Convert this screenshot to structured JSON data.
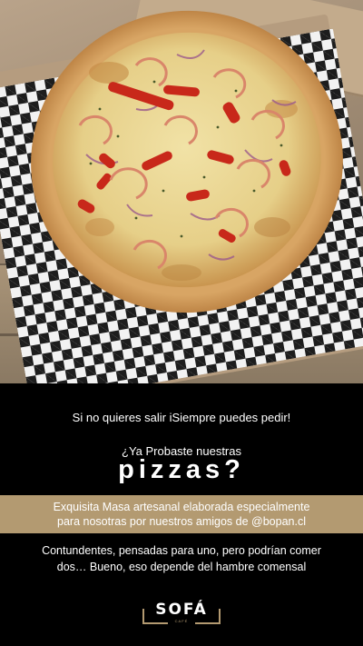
{
  "hero_photo": {
    "subject": "shrimp-pizza-in-box",
    "colors": {
      "cardboard": "#b59c7f",
      "crust": "#d49c5a",
      "cheese": "#e8d79a",
      "shrimp": "#f1bfa4",
      "pepper": "#c8281a"
    }
  },
  "promo": {
    "tagline": "Si no quieres salir iSiempre puedes pedir!",
    "question": "¿Ya Probaste nuestras",
    "headline": "pizzas?",
    "band": {
      "line1": "Exquisita Masa artesanal elaborada especialmente",
      "line2": "para nosotras por nuestros amigos de @bopan.cl",
      "color": "#b39a71"
    },
    "body": {
      "line1": "Contundentes, pensadas para uno, pero podrían comer",
      "line2": "dos… Bueno, eso depende del hambre comensal"
    }
  },
  "brand": {
    "name": "SOFÁ",
    "sub": "CAFÉ",
    "accent": "#b39a71"
  }
}
